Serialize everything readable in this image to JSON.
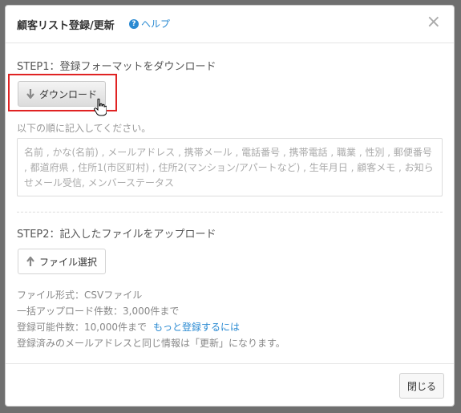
{
  "modal": {
    "title": "顧客リスト登録/更新",
    "help_label": "ヘルプ",
    "help_icon": "question-circle-icon",
    "close_icon": "close-icon"
  },
  "step1": {
    "title": "STEP1：登録フォーマットをダウンロード",
    "download_label": "ダウンロード",
    "download_icon": "arrow-down-icon",
    "hint": "以下の順に記入してください。",
    "format_text": "名前 , かな(名前) , メールアドレス , 携帯メール , 電話番号 , 携帯電話 , 職業 , 性別 , 郵便番号 , 都道府県 , 住所1(市区町村) , 住所2(マンション/アパートなど) , 生年月日 , 顧客メモ , お知らせメール受信, メンバーステータス"
  },
  "step2": {
    "title": "STEP2：記入したファイルをアップロード",
    "file_select_label": "ファイル選択",
    "file_select_icon": "arrow-up-icon",
    "file_format": "ファイル形式：CSVファイル",
    "bulk_limit": "一括アップロード件数：3,000件まで",
    "registrable_limit": "登録可能件数：10,000件まで",
    "more_link": "もっと登録するには",
    "note": "登録済みのメールアドレスと同じ情報は「更新」になります。"
  },
  "footer": {
    "close_label": "閉じる"
  },
  "colors": {
    "accent": "#2a8ad2",
    "highlight": "#e02323",
    "overlay": "#6f6f6f"
  }
}
